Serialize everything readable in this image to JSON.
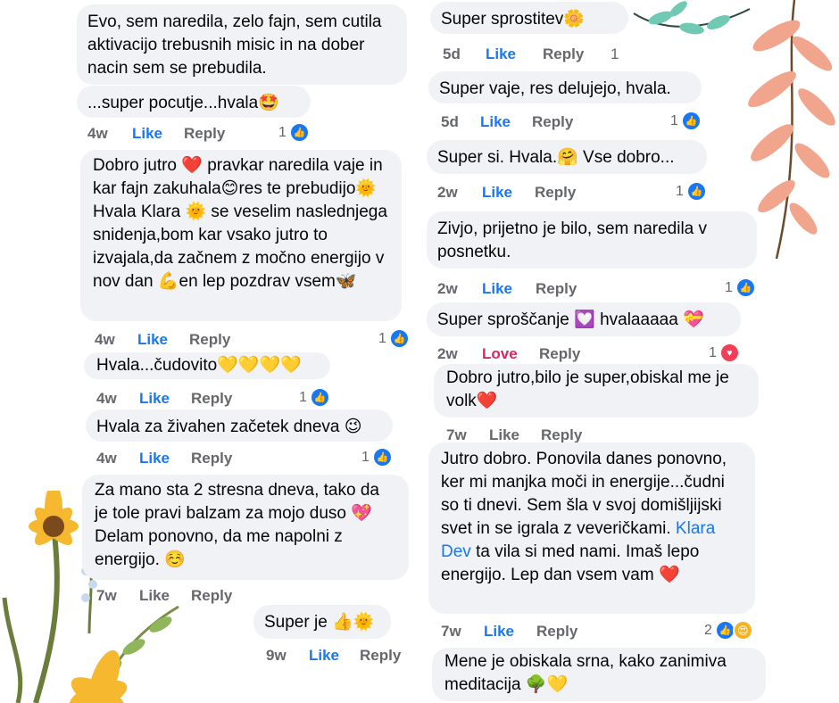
{
  "colors": {
    "bubble": "#f0f2f5",
    "like": "#1877f2",
    "love": "#e0245e",
    "meta": "#65676b"
  },
  "left": [
    {
      "text": "Evo, sem naredila, zelo fajn, sem cutila aktivacijo trebusnih misic in na dober nacin sem se prebudila.",
      "time": "",
      "like": "",
      "reply": "",
      "count": ""
    },
    {
      "text": "...super pocutje...hvala🤩",
      "time": "4w",
      "like": "Like",
      "reply": "Reply",
      "count": "1"
    },
    {
      "text": "Dobro jutro ❤️ pravkar naredila vaje in kar fajn zakuhala😊res te prebudijo🌞 Hvala Klara 🌞 se veselim naslednjega snidenja,bom kar vsako jutro to izvajala,da začnem z močno energijo v nov dan 💪en lep pozdrav vsem🦋",
      "time": "4w",
      "like": "Like",
      "reply": "Reply",
      "count": "1"
    },
    {
      "text": "Hvala...čudovito💛💛💛💛",
      "time": "4w",
      "like": "Like",
      "reply": "Reply",
      "count": "1"
    },
    {
      "text": "Hvala za živahen začetek dneva 😉",
      "time": "4w",
      "like": "Like",
      "reply": "Reply",
      "count": "1"
    },
    {
      "text": "Za mano sta 2 stresna dneva, tako da je tole pravi balzam za mojo duso 💖 Delam ponovno, da me napolni z energijo. ☺️",
      "time": "7w",
      "like": "Like",
      "reply": "Reply",
      "count": ""
    },
    {
      "text": "Super je 👍🌞",
      "time": "9w",
      "like": "Like",
      "reply": "Reply",
      "count": ""
    }
  ],
  "right": [
    {
      "text": "Super sprostitev🌼",
      "time": "5d",
      "like": "Like",
      "reply": "Reply",
      "count": "1"
    },
    {
      "text": "Super vaje, res delujejo, hvala.",
      "time": "5d",
      "like": "Like",
      "reply": "Reply",
      "count": "1"
    },
    {
      "text": "Super si. Hvala.🤗 Vse dobro...",
      "time": "2w",
      "like": "Like",
      "reply": "Reply",
      "count": "1"
    },
    {
      "text": "Zivjo, prijetno je bilo, sem naredila v posnetku.",
      "time": "2w",
      "like": "Like",
      "reply": "Reply",
      "count": "1"
    },
    {
      "text": "Super sproščanje 💟 hvalaaaaa 💝",
      "time": "2w",
      "like": "Love",
      "reply": "Reply",
      "count": "1"
    },
    {
      "text": "Dobro jutro,bilo je super,obiskal me je volk❤️",
      "time": "7w",
      "like": "Like",
      "reply": "Reply",
      "count": ""
    },
    {
      "text_before": "Jutro dobro.  Ponovila danes ponovno, ker mi manjka moči in energije...čudni so ti dnevi. Sem šla v svoj domišljijski svet in se igrala z veveričkami. ",
      "mention": "Klara Dev",
      "text_after": " ta vila si med nami. Imaš lepo energijo. Lep dan vsem vam ❤️",
      "time": "7w",
      "like": "Like",
      "reply": "Reply",
      "count": "2"
    },
    {
      "text": "Mene je obiskala srna, kako zanimiva meditacija 🌳💛"
    }
  ]
}
